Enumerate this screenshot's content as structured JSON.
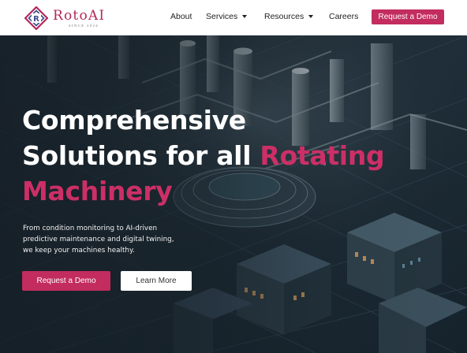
{
  "brand": {
    "name": "RotoAI",
    "tagline": "SINCE 2024",
    "mark_letter": "R",
    "primary_color": "#c22c5e"
  },
  "nav": {
    "items": [
      {
        "label": "About",
        "dropdown": false
      },
      {
        "label": "Services",
        "dropdown": true
      },
      {
        "label": "Resources",
        "dropdown": true
      },
      {
        "label": "Careers",
        "dropdown": false
      }
    ],
    "cta_label": "Request a Demo"
  },
  "hero": {
    "headline_line1": "Comprehensive",
    "headline_line2_white": "Solutions for all ",
    "headline_line2_accent": "Rotating",
    "headline_line3_accent": "Machinery",
    "subtext": "From condition monitoring to AI-driven predictive maintenance and digital twining, we keep your machines healthy.",
    "primary_button": "Request a Demo",
    "secondary_button": "Learn More",
    "accent_color": "#cc2f66",
    "background_image": "isometric-industrial-plant-illustration"
  }
}
